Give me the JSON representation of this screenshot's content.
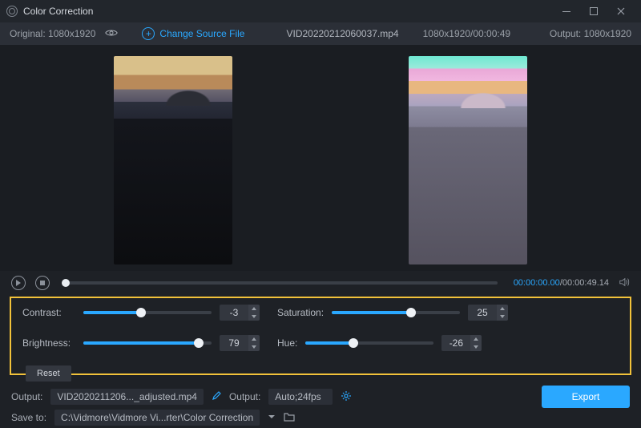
{
  "titlebar": {
    "title": "Color Correction"
  },
  "infobar": {
    "original_label": "Original: 1080x1920",
    "change_source_label": "Change Source File",
    "filename": "VID20220212060037.mp4",
    "meta": "1080x1920/00:00:49",
    "output_label": "Output: 1080x1920"
  },
  "playback": {
    "current_time": "00:00:00.00",
    "total_time": "00:00:49.14"
  },
  "sliders": {
    "contrast": {
      "label": "Contrast:",
      "value": "-3",
      "fill_pct": 45,
      "knob_pct": 45
    },
    "brightness": {
      "label": "Brightness:",
      "value": "79",
      "fill_pct": 90,
      "knob_pct": 90
    },
    "saturation": {
      "label": "Saturation:",
      "value": "25",
      "fill_pct": 62,
      "knob_pct": 62
    },
    "hue": {
      "label": "Hue:",
      "value": "-26",
      "fill_pct": 37,
      "knob_pct": 37
    }
  },
  "reset_label": "Reset",
  "output": {
    "label": "Output:",
    "filename": "VID2020211206..._adjusted.mp4",
    "settings_label": "Output:",
    "settings_value": "Auto;24fps"
  },
  "save": {
    "label": "Save to:",
    "path": "C:\\Vidmore\\Vidmore Vi...rter\\Color Correction"
  },
  "export_label": "Export"
}
